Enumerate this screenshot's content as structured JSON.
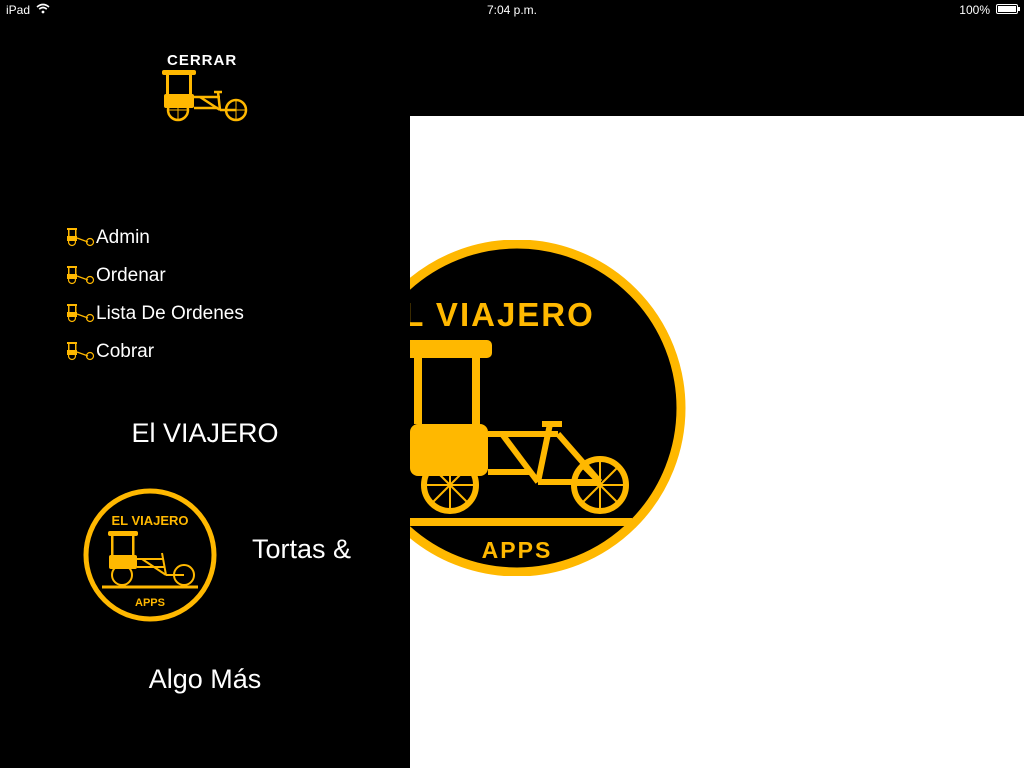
{
  "status_bar": {
    "device": "iPad",
    "time": "7:04 p.m.",
    "battery": "100%",
    "battery_level": 1.0
  },
  "drawer": {
    "close_label": "CERRAR",
    "menu": [
      {
        "label": "Admin"
      },
      {
        "label": "Ordenar"
      },
      {
        "label": "Lista De Ordenes"
      },
      {
        "label": "Cobrar"
      }
    ],
    "brand_title": "El VIAJERO",
    "tagline_1": "Tortas &",
    "tagline_2": "Algo Más",
    "logo_text_top": "EL VIAJERO",
    "logo_text_bottom": "APPS"
  },
  "main": {
    "logo_text_top": "EL VIAJERO",
    "logo_text_bottom": "APPS"
  },
  "colors": {
    "accent": "#FFB800",
    "background": "#000000",
    "panel": "#FFFFFF"
  },
  "icons": [
    "wifi-icon",
    "battery-icon",
    "cart-icon"
  ]
}
